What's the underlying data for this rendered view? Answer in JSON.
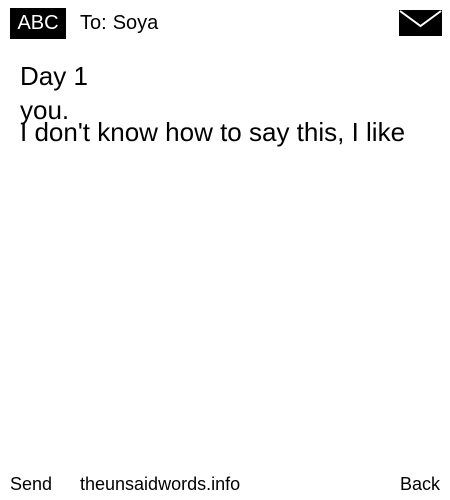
{
  "header": {
    "input_mode": "ABC",
    "to_label": "To:",
    "recipient": "Soya",
    "mail_icon": "envelope-icon"
  },
  "message": {
    "title": "Day 1",
    "lines": [
      "I don't know how to say this, I like",
      "you."
    ]
  },
  "footer": {
    "left_softkey": "Send",
    "site": "theunsaidwords.info",
    "right_softkey": "Back"
  }
}
